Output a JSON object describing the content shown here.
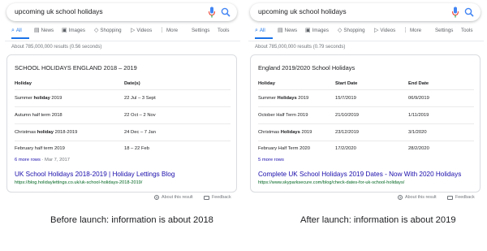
{
  "before": {
    "query": "upcoming uk school holidays",
    "tabs": [
      {
        "label": "All",
        "icon": "search-icon"
      },
      {
        "label": "News",
        "icon": "news-icon"
      },
      {
        "label": "Images",
        "icon": "image-icon"
      },
      {
        "label": "Shopping",
        "icon": "tag-icon"
      },
      {
        "label": "Videos",
        "icon": "play-icon"
      },
      {
        "label": "More",
        "icon": "more-icon"
      },
      {
        "label": "Settings"
      },
      {
        "label": "Tools"
      }
    ],
    "results_count": "About 785,000,000 results (0.56 seconds)",
    "card_title": "SCHOOL HOLIDAYS ENGLAND 2018 – 2019",
    "headers": [
      "Holiday",
      "Date(s)"
    ],
    "rows": [
      {
        "pre": "Summer ",
        "bold": "holiday",
        "post": " 2019",
        "c1": "22 Jul – 3 Sept"
      },
      {
        "pre": "Autumn half term 2018",
        "bold": "",
        "post": "",
        "c1": "22 Oct – 2 Nov"
      },
      {
        "pre": "Christmas ",
        "bold": "holiday",
        "post": " 2018-2019",
        "c1": "24 Dec – 7 Jan"
      },
      {
        "pre": "February half term 2019",
        "bold": "",
        "post": "",
        "c1": "18 – 22 Feb"
      }
    ],
    "more_rows": "6 more rows",
    "more_date": " · Mar 7, 2017",
    "result_title": "UK School Holidays 2018-2019 | Holiday Lettings Blog",
    "result_url": "https://blog.holidaylettings.co.uk/uk-school-holidays-2018-2019/",
    "about_label": "About this result",
    "feedback_label": "Feedback",
    "caption": "Before launch: information is about 2018"
  },
  "after": {
    "query": "upcoming uk school holidays",
    "tabs": [
      {
        "label": "All",
        "icon": "search-icon"
      },
      {
        "label": "News",
        "icon": "news-icon"
      },
      {
        "label": "Images",
        "icon": "image-icon"
      },
      {
        "label": "Shopping",
        "icon": "tag-icon"
      },
      {
        "label": "Videos",
        "icon": "play-icon"
      },
      {
        "label": "More",
        "icon": "more-icon"
      },
      {
        "label": "Settings"
      },
      {
        "label": "Tools"
      }
    ],
    "results_count": "About 785,000,000 results (0.79 seconds)",
    "card_title": "England 2019/2020 School Holidays",
    "headers": [
      "Holiday",
      "Start Date",
      "End Date"
    ],
    "rows": [
      {
        "pre": "Summer ",
        "bold": "Holidays",
        "post": " 2019",
        "c1": "15/7/2019",
        "c2": "06/9/2019"
      },
      {
        "pre": "October Half Term 2019",
        "bold": "",
        "post": "",
        "c1": "21/10/2019",
        "c2": "1/11/2019"
      },
      {
        "pre": "Christmas ",
        "bold": "Holidays",
        "post": " 2019",
        "c1": "23/12/2019",
        "c2": "3/1/2020"
      },
      {
        "pre": "February Half Term 2020",
        "bold": "",
        "post": "",
        "c1": "17/2/2020",
        "c2": "28/2/2020"
      }
    ],
    "more_rows": "5 more rows",
    "more_date": "",
    "result_title": "Complete UK School Holidays 2019 Dates - Now With 2020 Holidays",
    "result_url": "https://www.skyparksecure.com/blog/check-dates-for-uk-school-holidays/",
    "about_label": "About this result",
    "feedback_label": "Feedback",
    "caption": "After launch: information is about 2019"
  },
  "colors": {
    "accent": "#1a73e8",
    "link": "#1a0dab",
    "url": "#006621",
    "muted": "#70757a",
    "mic_red": "#ea4335"
  }
}
